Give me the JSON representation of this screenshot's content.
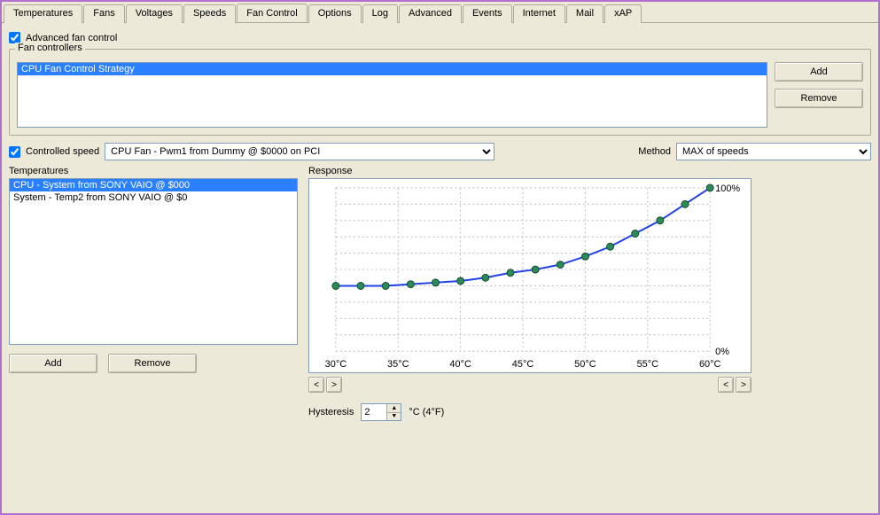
{
  "tabs": [
    "Temperatures",
    "Fans",
    "Voltages",
    "Speeds",
    "Fan Control",
    "Options",
    "Log",
    "Advanced",
    "Events",
    "Internet",
    "Mail",
    "xAP"
  ],
  "active_tab_index": 4,
  "advanced_checkbox": {
    "label": "Advanced fan control",
    "checked": true
  },
  "fan_controllers": {
    "label": "Fan controllers",
    "items": [
      "CPU Fan Control Strategy"
    ],
    "selected_index": 0,
    "add_label": "Add",
    "remove_label": "Remove"
  },
  "controlled_speed": {
    "checkbox_label": "Controlled speed",
    "checked": true,
    "combo_selected": "CPU Fan - Pwm1 from Dummy @ $0000 on PCI"
  },
  "method": {
    "label": "Method",
    "combo_selected": "MAX of speeds"
  },
  "temperatures": {
    "label": "Temperatures",
    "items": [
      "CPU - System from SONY VAIO @ $000",
      "System - Temp2 from SONY VAIO @ $0"
    ],
    "selected_index": 0,
    "add_label": "Add",
    "remove_label": "Remove"
  },
  "response": {
    "label": "Response",
    "y_max_label": "100%",
    "y_min_label": "0%"
  },
  "chart_data": {
    "type": "line",
    "xlabel": "",
    "ylabel": "",
    "x_ticks": [
      "30°C",
      "35°C",
      "40°C",
      "45°C",
      "50°C",
      "55°C",
      "60°C"
    ],
    "x_values": [
      30,
      32,
      34,
      36,
      38,
      40,
      42,
      44,
      46,
      48,
      50,
      52,
      54,
      56,
      58,
      60
    ],
    "y_values": [
      40,
      40,
      40,
      41,
      42,
      43,
      45,
      48,
      50,
      53,
      58,
      64,
      72,
      80,
      90,
      100
    ],
    "xlim": [
      30,
      60
    ],
    "ylim": [
      0,
      100
    ],
    "grid": true,
    "legend": false
  },
  "prev_icon": "<",
  "next_icon": ">",
  "hysteresis": {
    "label": "Hysteresis",
    "value": "2",
    "suffix": "°C (4°F)"
  }
}
